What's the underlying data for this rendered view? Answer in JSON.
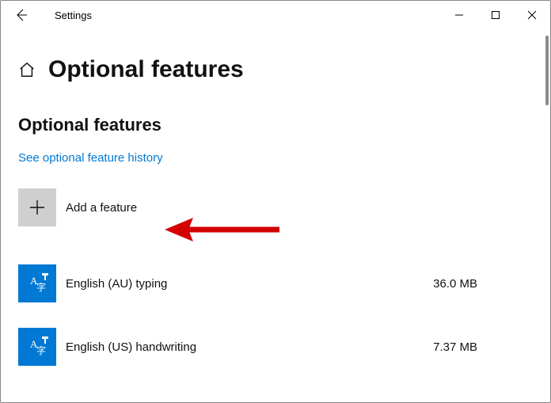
{
  "window": {
    "app_title": "Settings"
  },
  "page": {
    "title": "Optional features",
    "section_title": "Optional features",
    "history_link": "See optional feature history",
    "add_label": "Add a feature"
  },
  "features": [
    {
      "name": "English (AU) typing",
      "size": "36.0 MB"
    },
    {
      "name": "English (US) handwriting",
      "size": "7.37 MB"
    }
  ],
  "annotation": {
    "kind": "arrow",
    "target": "add-feature-button",
    "color": "#d40000"
  }
}
